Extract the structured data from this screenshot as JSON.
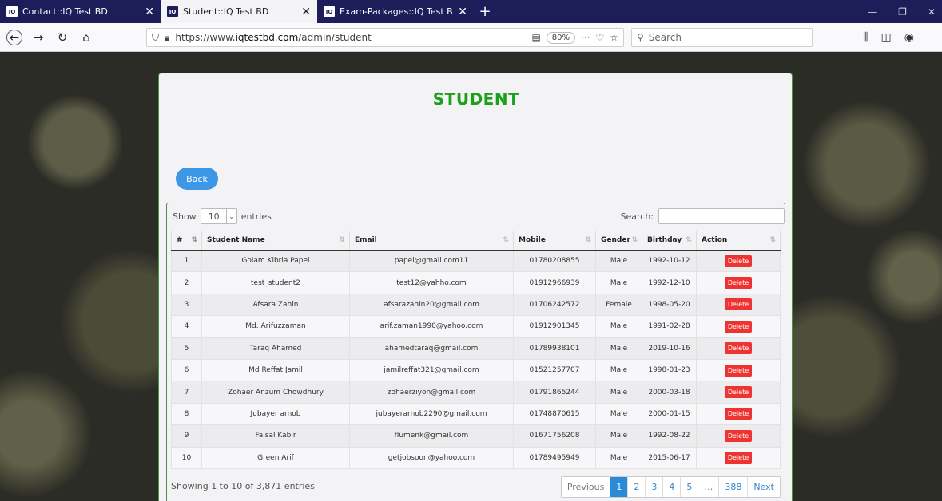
{
  "browser": {
    "tabs": [
      {
        "favicon": "IQ",
        "title": "Contact::IQ Test BD"
      },
      {
        "favicon": "IQ",
        "title": "Student::IQ Test BD"
      },
      {
        "favicon": "IQ",
        "title": "Exam-Packages::IQ Test BD"
      }
    ],
    "url_prefix": "https://www.",
    "url_host": "iqtestbd.com",
    "url_path": "/admin/student",
    "zoom": "80%",
    "search_placeholder": "Search"
  },
  "page": {
    "title": "STUDENT",
    "back_label": "Back",
    "show_label": "Show",
    "entries_value": "10",
    "entries_label": "entries",
    "search_label": "Search:",
    "columns": [
      "#",
      "Student Name",
      "Email",
      "Mobile",
      "Gender",
      "Birthday",
      "Action"
    ],
    "delete_label": "Delete",
    "rows": [
      [
        "1",
        "Golam Kibria Papel",
        "papel@gmail.com11",
        "01780208855",
        "Male",
        "1992-10-12"
      ],
      [
        "2",
        "test_student2",
        "test12@yahho.com",
        "01912966939",
        "Male",
        "1992-12-10"
      ],
      [
        "3",
        "Afsara Zahin",
        "afsarazahin20@gmail.com",
        "01706242572",
        "Female",
        "1998-05-20"
      ],
      [
        "4",
        "Md. Arifuzzaman",
        "arif.zaman1990@yahoo.com",
        "01912901345",
        "Male",
        "1991-02-28"
      ],
      [
        "5",
        "Taraq Ahamed",
        "ahamedtaraq@gmail.com",
        "01789938101",
        "Male",
        "2019-10-16"
      ],
      [
        "6",
        "Md Reffat Jamil",
        "jamilreffat321@gmail.com",
        "01521257707",
        "Male",
        "1998-01-23"
      ],
      [
        "7",
        "Zohaer Anzum Chowdhury",
        "zohaerziyon@gmail.com",
        "01791865244",
        "Male",
        "2000-03-18"
      ],
      [
        "8",
        "Jubayer arnob",
        "jubayerarnob2290@gmail.com",
        "01748870615",
        "Male",
        "2000-01-15"
      ],
      [
        "9",
        "Faisal Kabir",
        "flumenk@gmail.com",
        "01671756208",
        "Male",
        "1992-08-22"
      ],
      [
        "10",
        "Green Arif",
        "getjobsoon@yahoo.com",
        "01789495949",
        "Male",
        "2015-06-17"
      ]
    ],
    "info": "Showing 1 to 10 of 3,871 entries",
    "pagination": [
      "Previous",
      "1",
      "2",
      "3",
      "4",
      "5",
      "…",
      "388",
      "Next"
    ],
    "active_page": "1"
  }
}
